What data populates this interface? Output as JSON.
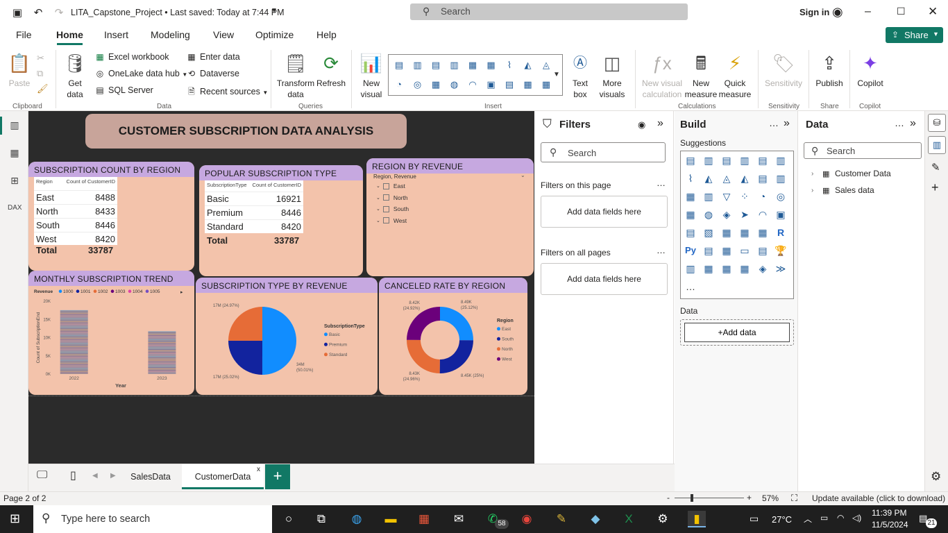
{
  "app": {
    "doc_title": "LITA_Capstone_Project • Last saved: Today at 7:44 PM",
    "search_placeholder": "Search",
    "sign_in": "Sign in"
  },
  "menu": {
    "file": "File",
    "home": "Home",
    "insert": "Insert",
    "modeling": "Modeling",
    "view": "View",
    "optimize": "Optimize",
    "help": "Help",
    "share": "Share"
  },
  "ribbon": {
    "paste": "Paste",
    "get_data": "Get data",
    "excel": "Excel workbook",
    "onelake": "OneLake data hub",
    "sql": "SQL Server",
    "enter_data": "Enter data",
    "dataverse": "Dataverse",
    "recent": "Recent sources",
    "transform": "Transform data",
    "refresh": "Refresh",
    "new_visual": "New visual",
    "text_box": "Text box",
    "more_visuals": "More visuals",
    "new_visual_calc": "New visual calculation",
    "new_measure": "New measure",
    "quick_measure": "Quick measure",
    "sensitivity": "Sensitivity",
    "publish": "Publish",
    "copilot": "Copilot",
    "groups": {
      "clipboard": "Clipboard",
      "data": "Data",
      "queries": "Queries",
      "insert": "Insert",
      "calculations": "Calculations",
      "sensitivity": "Sensitivity",
      "share": "Share",
      "copilot": "Copilot"
    }
  },
  "report": {
    "title": "CUSTOMER SUBSCRIPTION DATA ANALYSIS",
    "region_count": {
      "title": "SUBSCRIPTION COUNT BY REGION",
      "col1": "Region",
      "col2": "Count of CustomerID",
      "rows": [
        {
          "k": "East",
          "v": "8488"
        },
        {
          "k": "North",
          "v": "8433"
        },
        {
          "k": "South",
          "v": "8446"
        },
        {
          "k": "West",
          "v": "8420"
        }
      ],
      "total_label": "Total",
      "total_value": "33787"
    },
    "popular_type": {
      "title": "POPULAR SUBSCRIPTION TYPE",
      "col1": "SubscriptionType",
      "col2": "Count of CustomerID",
      "rows": [
        {
          "k": "Basic",
          "v": "16921"
        },
        {
          "k": "Premium",
          "v": "8446"
        },
        {
          "k": "Standard",
          "v": "8420"
        }
      ],
      "total_label": "Total",
      "total_value": "33787"
    },
    "region_revenue": {
      "title": "REGION BY REVENUE",
      "header": "Region, Revenue",
      "items": [
        "East",
        "North",
        "South",
        "West"
      ]
    },
    "monthly_trend": {
      "title": "MONTHLY SUBSCRIPTION TREND"
    },
    "type_revenue": {
      "title": "SUBSCRIPTION TYPE BY REVENUE"
    },
    "canceled_rate": {
      "title": "CANCELED RATE BY REGION"
    }
  },
  "chart_data": [
    {
      "type": "bar",
      "title": "",
      "legend_title": "Revenue",
      "legend": [
        "1000",
        "1001",
        "1002",
        "1003",
        "1004",
        "1005"
      ],
      "legend_colors": [
        "#118dff",
        "#12239e",
        "#e66c37",
        "#6b007b",
        "#e044a7",
        "#744ec2"
      ],
      "categories": [
        "2022",
        "2023"
      ],
      "values": [
        17500,
        11700
      ],
      "xlabel": "Year",
      "ylabel": "Count of SubscriptionEnd",
      "yticks": [
        "0K",
        "5K",
        "10K",
        "15K",
        "20K"
      ],
      "ylim": [
        0,
        20000
      ]
    },
    {
      "type": "pie",
      "legend_title": "SubscriptionType",
      "labels": [
        "Basic",
        "Premium",
        "Standard"
      ],
      "values": [
        50.01,
        25.02,
        24.97
      ],
      "data_labels": [
        "34M (50.01%)",
        "17M (25.02%)",
        "17M (24.97%)"
      ],
      "colors": [
        "#118dff",
        "#12239e",
        "#e66c37"
      ]
    },
    {
      "type": "pie",
      "subtype": "donut",
      "legend_title": "Region",
      "labels": [
        "East",
        "South",
        "North",
        "West"
      ],
      "values": [
        25.12,
        25,
        24.96,
        24.92
      ],
      "data_labels": [
        "8.49K (25.12%)",
        "8.45K (25%)",
        "8.43K (24.96%)",
        "8.42K (24.92%)"
      ],
      "colors": [
        "#118dff",
        "#12239e",
        "#e66c37",
        "#6b007b"
      ]
    }
  ],
  "filters": {
    "title": "Filters",
    "search": "Search",
    "on_page": "Filters on this page",
    "on_all": "Filters on all pages",
    "add_fields": "Add data fields here"
  },
  "build": {
    "title": "Build",
    "suggestions": "Suggestions",
    "data_label": "Data",
    "add_data": "+Add data"
  },
  "datapane": {
    "title": "Data",
    "search": "Search",
    "tables": [
      "Customer Data",
      "Sales data"
    ]
  },
  "pages": {
    "tab1": "SalesData",
    "tab2": "CustomerData"
  },
  "status": {
    "page": "Page 2 of 2",
    "zoom": "57%",
    "update": "Update available (click to download)"
  },
  "taskbar": {
    "search": "Type here to search",
    "temp": "27°C",
    "time": "11:39 PM",
    "date": "11/5/2024",
    "whatsapp_badge": "58",
    "notif_badge": "21"
  }
}
